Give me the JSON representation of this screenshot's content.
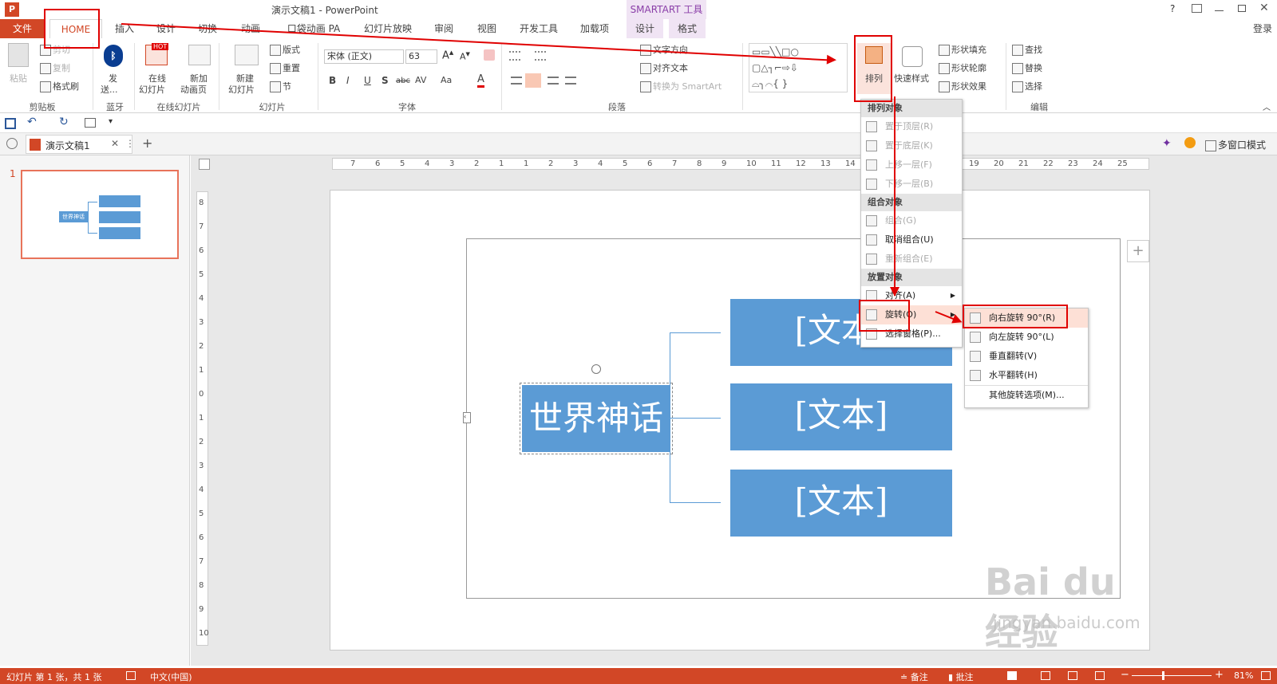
{
  "app": {
    "logo_label": "P",
    "title": "演示文稿1 - PowerPoint",
    "contextual_group": "SMARTART 工具",
    "help": "?",
    "login": "登录"
  },
  "tabs": [
    "文件",
    "HOME",
    "插入",
    "设计",
    "切换",
    "动画",
    "口袋动画 PA",
    "幻灯片放映",
    "审阅",
    "视图",
    "开发工具",
    "加载项",
    "设计",
    "格式"
  ],
  "ribbon": {
    "clipboard": {
      "paste": "粘贴",
      "cut": "剪切",
      "copy": "复制",
      "format_painter": "格式刷",
      "group": "剪贴板"
    },
    "bluetooth": {
      "send": "发",
      "send2": "送...",
      "group": "蓝牙"
    },
    "online": {
      "hot": "HOT",
      "online_slide": "在线",
      "online_slide2": "幻灯片",
      "new_anim": "新加",
      "new_anim2": "动画页",
      "group": "在线幻灯片"
    },
    "slides": {
      "new_slide": "新建",
      "new_slide2": "幻灯片",
      "layout": "版式",
      "reset": "重置",
      "section": "节",
      "group": "幻灯片"
    },
    "font": {
      "name": "宋体 (正文)",
      "size": "63",
      "bold": "B",
      "italic": "I",
      "underline": "U",
      "shadow": "S",
      "strike": "abc",
      "spacing": "AV",
      "case": "Aa",
      "color": "A",
      "group": "字体"
    },
    "paragraph": {
      "text_dir": "文字方向",
      "align_text": "对齐文本",
      "smartart": "转换为 SmartArt",
      "group": "段落"
    },
    "drawing": {
      "arrange": "排列",
      "quick_styles": "快速样式",
      "shape_fill": "形状填充",
      "shape_outline": "形状轮廓",
      "shape_effects": "形状效果",
      "group": "绘图"
    },
    "editing": {
      "find": "查找",
      "replace": "替换",
      "select": "选择",
      "group": "编辑"
    }
  },
  "doc_tab": {
    "name": "演示文稿1",
    "multi_window": "多窗口模式"
  },
  "thumb": {
    "number": "1",
    "center": "世界神话"
  },
  "ruler_h": [
    "7",
    "6",
    "5",
    "4",
    "3",
    "2",
    "1",
    "1",
    "2",
    "3",
    "4",
    "5",
    "6",
    "7",
    "8",
    "9",
    "10",
    "11",
    "12",
    "13",
    "14",
    "15",
    "16",
    "17",
    "18",
    "19",
    "20",
    "21",
    "22",
    "23",
    "24",
    "25"
  ],
  "ruler_v": [
    "8",
    "7",
    "6",
    "5",
    "4",
    "3",
    "2",
    "1",
    "0",
    "1",
    "2",
    "3",
    "4",
    "5",
    "6",
    "7",
    "8",
    "9",
    "10"
  ],
  "smartart": {
    "center": "世界神话",
    "items": [
      "[文本]",
      "[文本]",
      "[文本]"
    ]
  },
  "arrange_menu": {
    "h1": "排列对象",
    "bring_front": "置于顶层(R)",
    "send_back": "置于底层(K)",
    "forward": "上移一层(F)",
    "backward": "下移一层(B)",
    "h2": "组合对象",
    "group": "组合(G)",
    "ungroup": "取消组合(U)",
    "regroup": "重新组合(E)",
    "h3": "放置对象",
    "align": "对齐(A)",
    "rotate": "旋转(O)",
    "selection_pane": "选择窗格(P)..."
  },
  "rotate_menu": {
    "right90": "向右旋转 90°(R)",
    "left90": "向左旋转 90°(L)",
    "flip_v": "垂直翻转(V)",
    "flip_h": "水平翻转(H)",
    "more": "其他旋转选项(M)..."
  },
  "status": {
    "slide_info": "幻灯片 第 1 张，共 1 张",
    "lang": "中文(中国)",
    "notes": "备注",
    "comments": "批注",
    "zoom": "81%"
  },
  "watermark": {
    "brand": "Bai du 经验",
    "url": "jingyan.baidu.com"
  }
}
